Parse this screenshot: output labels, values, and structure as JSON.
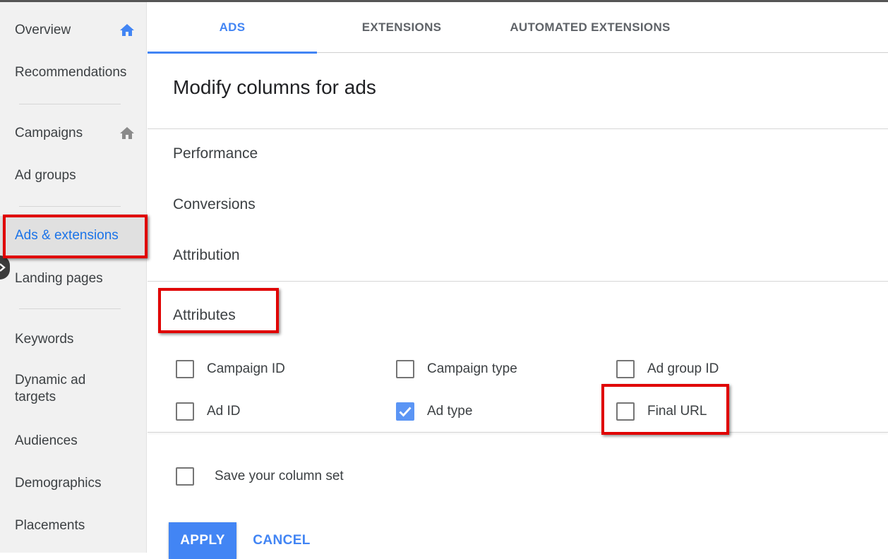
{
  "sidebar": {
    "items": [
      {
        "label": "Overview",
        "icon": "home-icon"
      },
      {
        "label": "Recommendations"
      },
      {
        "label": "Campaigns",
        "icon": "home-icon"
      },
      {
        "label": "Ad groups"
      },
      {
        "label": "Ads & extensions",
        "active": true
      },
      {
        "label": "Landing pages"
      },
      {
        "label": "Keywords"
      },
      {
        "label": "Dynamic ad targets"
      },
      {
        "label": "Audiences"
      },
      {
        "label": "Demographics"
      },
      {
        "label": "Placements"
      }
    ]
  },
  "tabs": [
    {
      "label": "ADS",
      "active": true
    },
    {
      "label": "EXTENSIONS"
    },
    {
      "label": "AUTOMATED EXTENSIONS"
    }
  ],
  "panel": {
    "title": "Modify columns for ads",
    "sections": [
      "Performance",
      "Conversions",
      "Attribution",
      "Attributes"
    ],
    "attributes": [
      {
        "label": "Campaign ID",
        "checked": false
      },
      {
        "label": "Campaign type",
        "checked": false
      },
      {
        "label": "Ad group ID",
        "checked": false
      },
      {
        "label": "Ad ID",
        "checked": false
      },
      {
        "label": "Ad type",
        "checked": true
      },
      {
        "label": "Final URL",
        "checked": false
      }
    ],
    "save_column_set": {
      "label": "Save your column set",
      "checked": false
    },
    "apply_label": "APPLY",
    "cancel_label": "CANCEL"
  },
  "colors": {
    "accent": "#4285f4",
    "highlight": "#e00000",
    "checkbox_checked": "#5b95f5"
  }
}
